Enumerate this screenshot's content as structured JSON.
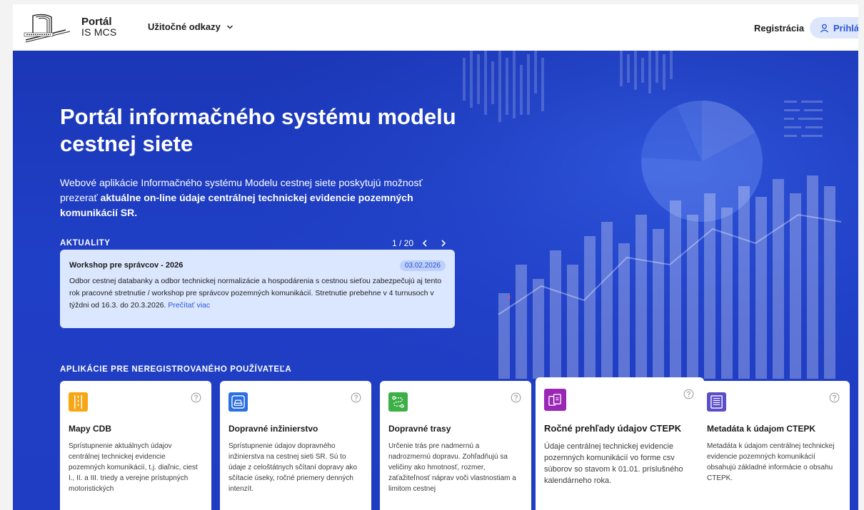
{
  "header": {
    "logo_title": "Portál",
    "logo_subtitle": "IS MCS",
    "useful_links": "Užitočné odkazy",
    "register": "Registrácia",
    "login": "Prihlás"
  },
  "hero": {
    "title": "Portál informačného systému modelu cestnej siete",
    "description_plain": "Webové aplikácie Informačného systému Modelu cestnej siete poskytujú možnosť prezerať ",
    "description_bold": "aktuálne on-line údaje centrálnej technickej evidencie pozemných komunikácií SR."
  },
  "news": {
    "label": "AKTUALITY",
    "pager": "1 / 20",
    "title": "Workshop pre správcov - 2026",
    "date": "03.02.2026",
    "text": "Odbor cestnej databanky a odbor technickej normalizácie a hospodárenia s cestnou sieťou zabezpečujú aj tento rok pracovné stretnutie / workshop pre správcov pozemných komunikácií. Stretnutie prebehne v 4 turnusoch v týždni od 16.3. do 20.3.2026. ",
    "read_more": "Prečítať viac"
  },
  "apps": {
    "label": "APLIKÁCIE PRE NEREGISTROVANÉHO POUŽÍVATEĽA",
    "items": [
      {
        "title": "Mapy CDB",
        "text": "Sprístupnenie aktuálnych údajov centrálnej technickej evidencie pozemných komunikácií, t.j. diaľnic, ciest I., II. a III. triedy a verejne prístupných motoristických",
        "icon": "road-icon",
        "color": "#f7a614"
      },
      {
        "title": "Dopravné inžinierstvo",
        "text": "Sprístupnenie údajov dopravného inžinierstva na cestnej sieti SR. Sú to údaje z celoštátnych sčítaní dopravy ako sčítacie úseky, ročné priemery denných intenzít.",
        "icon": "car-icon",
        "color": "#2d6fe0"
      },
      {
        "title": "Dopravné trasy",
        "text": "Určenie trás pre nadmernú a nadrozmernú dopravu. Zohľadňujú sa veličiny ako hmotnosť, rozmer, zaťažiteľnosť náprav voči vlastnostiam a limitom cestnej",
        "icon": "route-icon",
        "color": "#3cb047"
      },
      {
        "title": "Ročné prehľady údajov CTEPK",
        "text": "Údaje centrálnej technickej evidencie pozemných komunikácií vo forme csv súborov so stavom k 01.01. príslušného kalendárneho roka.",
        "icon": "documents-icon",
        "color": "#9b27b7"
      },
      {
        "title": "Metadáta k údajom CTEPK",
        "text": "Metadáta k údajom centrálnej technickej evidencie pozemných komunikácií obsahujú základné informácie o obsahu CTEPK.",
        "icon": "list-document-icon",
        "color": "#5b4ec9"
      }
    ]
  }
}
